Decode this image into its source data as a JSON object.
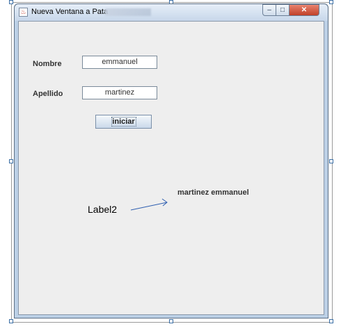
{
  "window": {
    "title": "Nueva Ventana a Pata",
    "controls": {
      "minimize": "–",
      "maximize": "□",
      "close": "✕"
    }
  },
  "form": {
    "nombre_label": "Nombre",
    "nombre_value": "emmanuel",
    "apellido_label": "Apellido",
    "apellido_value": "martinez",
    "iniciar_label": "iniciar",
    "result_text": "martinez emmanuel"
  },
  "annotation": {
    "label": "Label2",
    "arrow_color": "#2f5fb0"
  },
  "colors": {
    "window_bg": "#eeeeee",
    "title_gradient": [
      "#e6eef8",
      "#c7d7ea"
    ],
    "close_button": "#c0412a"
  }
}
